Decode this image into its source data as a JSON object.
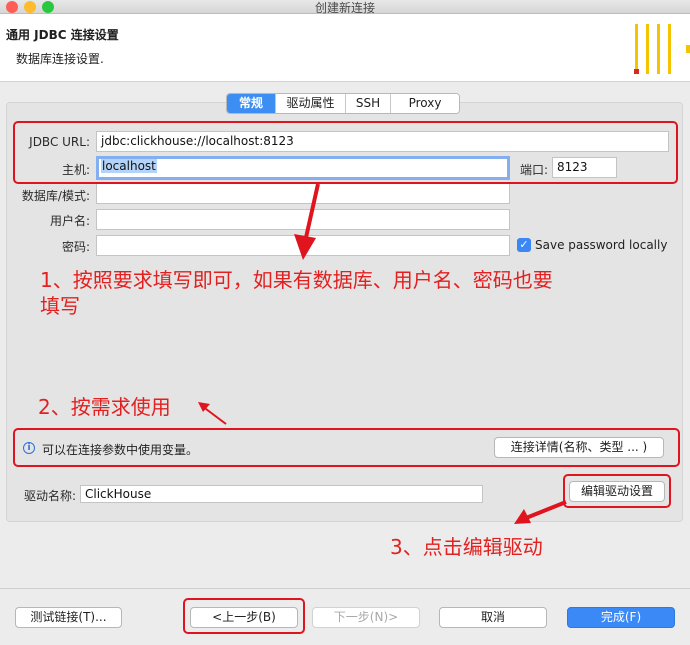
{
  "window": {
    "title": "创建新连接"
  },
  "header": {
    "title": "通用 JDBC 连接设置",
    "subtitle": "数据库连接设置."
  },
  "tabs": [
    {
      "label": "常规",
      "active": true
    },
    {
      "label": "驱动属性",
      "active": false
    },
    {
      "label": "SSH",
      "active": false
    },
    {
      "label": "Proxy",
      "active": false
    }
  ],
  "form": {
    "jdbc_url": {
      "label": "JDBC URL:",
      "value": "jdbc:clickhouse://localhost:8123"
    },
    "host": {
      "label": "主机:",
      "value": "localhost"
    },
    "port": {
      "label": "端口:",
      "value": "8123"
    },
    "database": {
      "label": "数据库/模式:",
      "value": ""
    },
    "username": {
      "label": "用户名:",
      "value": ""
    },
    "password": {
      "label": "密码:",
      "value": ""
    },
    "save_password": {
      "label": "Save password locally",
      "checked": true
    }
  },
  "info": {
    "text": "可以在连接参数中使用变量。",
    "details_button": "连接详情(名称、类型 ... )"
  },
  "driver": {
    "label": "驱动名称:",
    "value": "ClickHouse",
    "edit_button": "编辑驱动设置"
  },
  "annotations": {
    "note1_line1": "1、按照要求填写即可，如果有数据库、用户名、密码也要",
    "note1_line2": "填写",
    "note2": "2、按需求使用",
    "note3": "3、点击编辑驱动"
  },
  "footer": {
    "test": "测试链接(T)...",
    "back": "<上一步(B)",
    "next": "下一步(N)>",
    "cancel": "取消",
    "finish": "完成(F)"
  },
  "colors": {
    "accent": "#3c8ef3",
    "annotation_red": "#e0141e",
    "logo_yellow": "#f5c400"
  }
}
